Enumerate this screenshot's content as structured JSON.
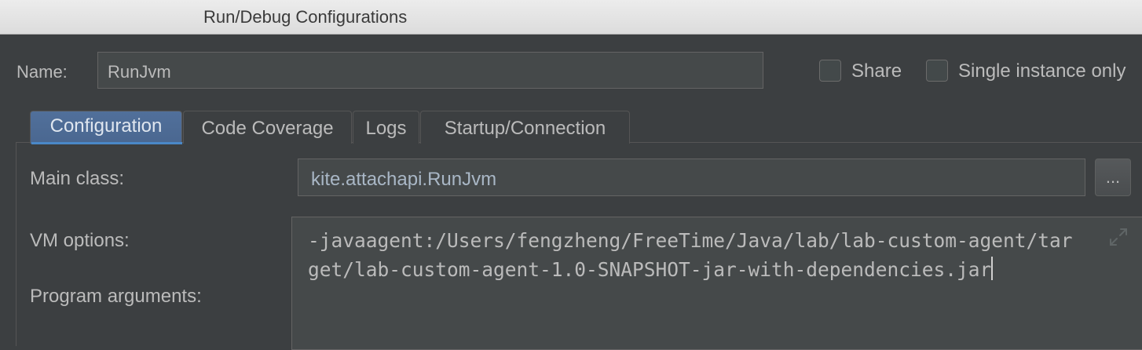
{
  "window": {
    "title": "Run/Debug Configurations"
  },
  "name_row": {
    "label": "Name:",
    "value": "RunJvm",
    "share_label": "Share",
    "single_instance_label": "Single instance only",
    "share_checked": false,
    "single_instance_checked": false
  },
  "tabs": [
    {
      "label": "Configuration",
      "selected": true
    },
    {
      "label": "Code Coverage",
      "selected": false
    },
    {
      "label": "Logs",
      "selected": false
    },
    {
      "label": "Startup/Connection",
      "selected": false
    }
  ],
  "configuration": {
    "main_class_label": "Main class:",
    "main_class_value": "kite.attachapi.RunJvm",
    "browse_label": "...",
    "vm_options_label": "VM options:",
    "vm_options_value": "-javaagent:/Users/fengzheng/FreeTime/Java/lab/lab-custom-agent/target/lab-custom-agent-1.0-SNAPSHOT-jar-with-dependencies.jar",
    "program_arguments_label": "Program arguments:"
  },
  "icons": {
    "vm_expand": "expand-arrows-icon"
  },
  "colors": {
    "background": "#3c3f41",
    "selected_tab": "#4a6790",
    "field_background": "#45494a"
  }
}
